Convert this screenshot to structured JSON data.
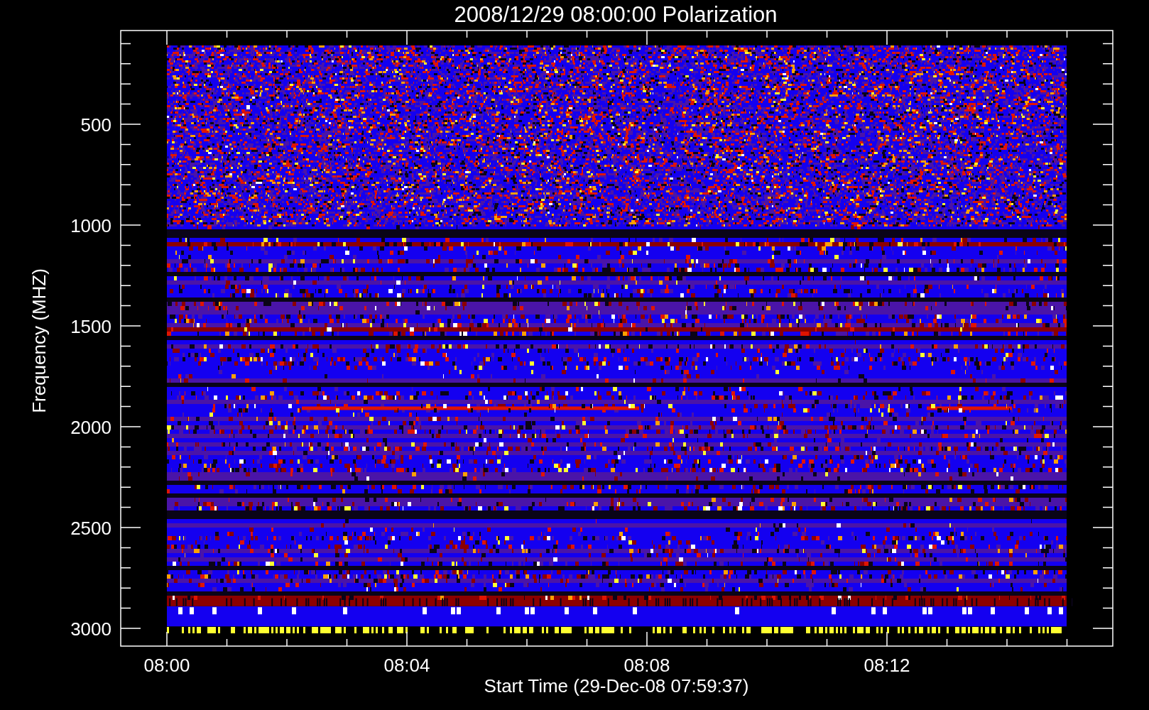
{
  "title": "2008/12/29 08:00:00 Polarization",
  "y_axis": {
    "label": "Frequency (MHZ)",
    "ticks": [
      "500",
      "1000",
      "1500",
      "2000",
      "2500",
      "3000"
    ]
  },
  "x_axis": {
    "label": "Start Time (29-Dec-08 07:59:37)",
    "ticks": [
      "08:00",
      "08:04",
      "08:08",
      "08:12"
    ]
  }
}
